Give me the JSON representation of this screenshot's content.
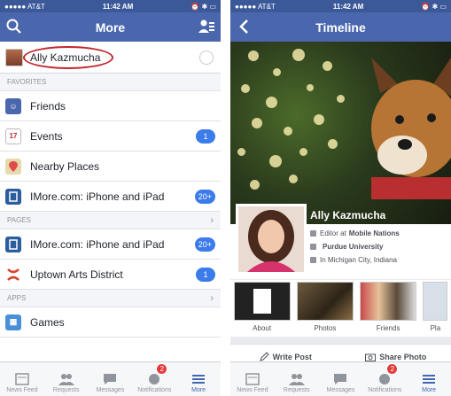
{
  "left": {
    "status": {
      "carrier": "●●●●● AT&T",
      "time": "11:42 AM",
      "right": "⏰ ✱ ▭"
    },
    "navbar": {
      "title": "More"
    },
    "profile": {
      "name": "Ally Kazmucha"
    },
    "sections": [
      {
        "title": "FAVORITES",
        "items": [
          {
            "label": "Friends",
            "icon": "friends-icon",
            "badge": ""
          },
          {
            "label": "Events",
            "icon": "calendar-icon",
            "badge": "1"
          },
          {
            "label": "Nearby Places",
            "icon": "map-pin-icon",
            "badge": ""
          },
          {
            "label": "IMore.com: iPhone and iPad",
            "icon": "page-icon",
            "badge": "20+"
          }
        ]
      },
      {
        "title": "PAGES",
        "items": [
          {
            "label": "IMore.com: iPhone and iPad",
            "icon": "page-icon",
            "badge": "20+"
          },
          {
            "label": "Uptown Arts District",
            "icon": "uptown-icon",
            "badge": "1"
          }
        ]
      },
      {
        "title": "APPS",
        "items": [
          {
            "label": "Games",
            "icon": "games-icon",
            "badge": ""
          }
        ]
      }
    ],
    "tabs": [
      {
        "label": "News Feed"
      },
      {
        "label": "Requests"
      },
      {
        "label": "Messages"
      },
      {
        "label": "Notifications",
        "badge": "2"
      },
      {
        "label": "More"
      }
    ]
  },
  "right": {
    "status": {
      "carrier": "●●●●● AT&T",
      "time": "11:42 AM",
      "right": "⏰ ✱ ▭"
    },
    "navbar": {
      "title": "Timeline"
    },
    "profile": {
      "name": "Ally Kazmucha",
      "info": [
        {
          "prefix": "Editor at",
          "value": "Mobile Nations"
        },
        {
          "prefix": "",
          "value": "Purdue University"
        },
        {
          "prefix": "",
          "value": "In Michigan City, Indiana"
        }
      ]
    },
    "grid": [
      {
        "label": "About"
      },
      {
        "label": "Photos"
      },
      {
        "label": "Friends"
      },
      {
        "label": "Pla"
      }
    ],
    "actions": [
      {
        "label": "Write Post"
      },
      {
        "label": "Share Photo"
      }
    ],
    "tabs": [
      {
        "label": "News Feed"
      },
      {
        "label": "Requests"
      },
      {
        "label": "Messages"
      },
      {
        "label": "Notifications",
        "badge": "2"
      },
      {
        "label": "More"
      }
    ]
  },
  "colors": {
    "facebook_blue": "#4a67ad",
    "badge_blue": "#3b7bea",
    "alert_red": "#e23b3b",
    "highlight_oval": "#c0272d"
  }
}
